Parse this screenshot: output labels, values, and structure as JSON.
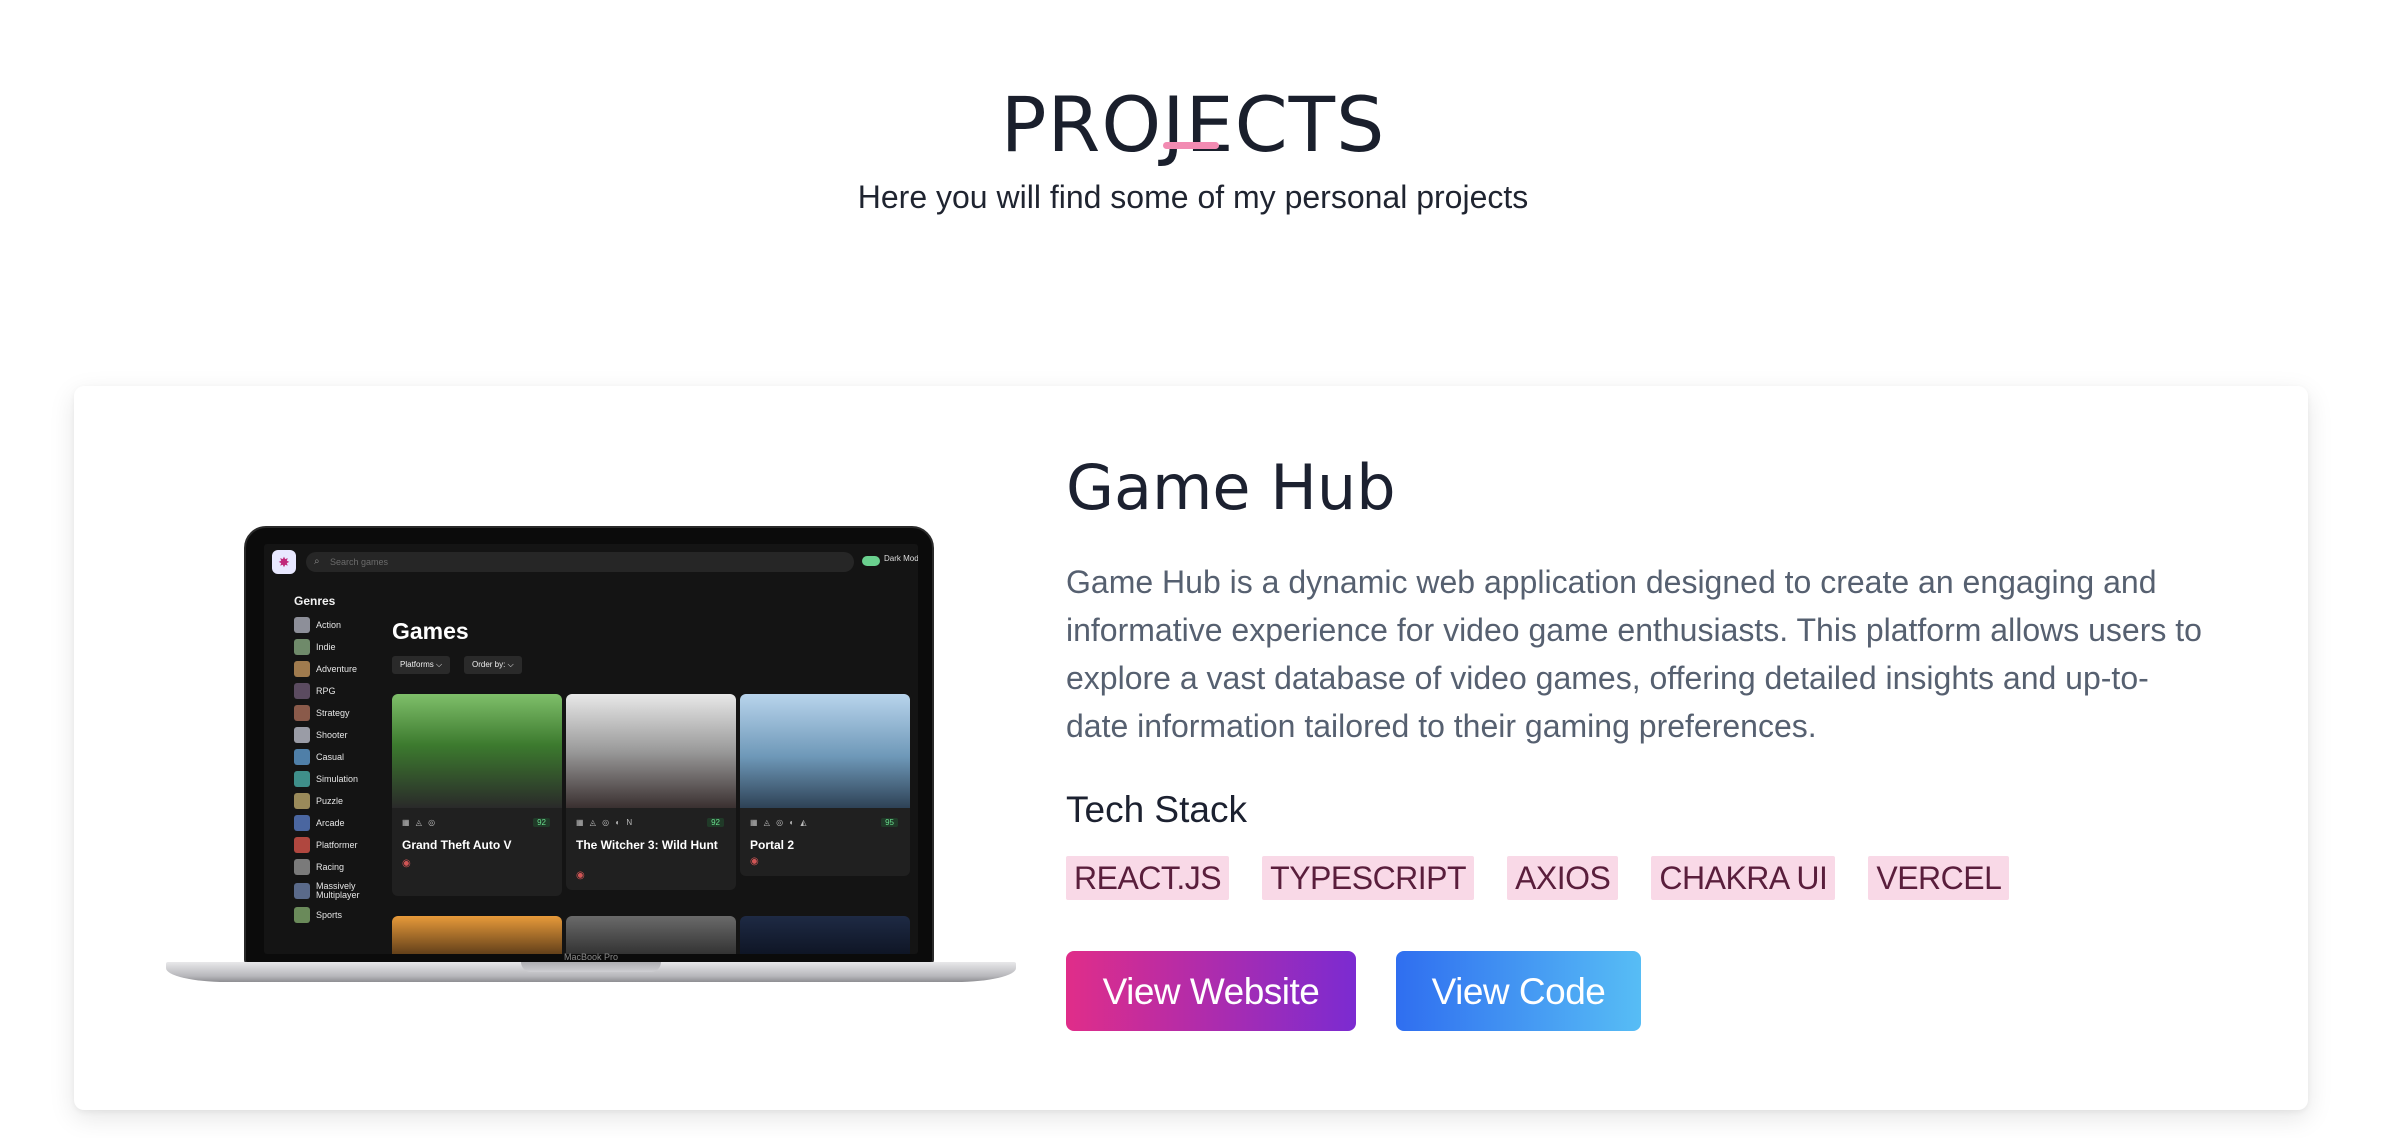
{
  "header": {
    "title": "PROJECTS",
    "subtitle": "Here you will find some of my personal projects",
    "accent_color": "#f28bb2"
  },
  "project": {
    "name": "Game Hub",
    "description": "Game Hub is a dynamic web application designed to create an engaging and informative experience for video game enthusiasts. This platform allows users to explore a vast database of video games, offering detailed insights and up-to-date information tailored to their gaming preferences.",
    "tech_stack_heading": "Tech Stack",
    "tech_stack": [
      "REACT.JS",
      "TYPESCRIPT",
      "AXIOS",
      "CHAKRA UI",
      "VERCEL"
    ],
    "buttons": {
      "view_website": "View Website",
      "view_code": "View Code"
    }
  },
  "screenshot": {
    "search_placeholder": "Search games",
    "dark_mode_label": "Dark Mode",
    "genres_heading": "Genres",
    "genres": [
      "Action",
      "Indie",
      "Adventure",
      "RPG",
      "Strategy",
      "Shooter",
      "Casual",
      "Simulation",
      "Puzzle",
      "Arcade",
      "Platformer",
      "Racing",
      "Massively Multiplayer",
      "Sports"
    ],
    "games_heading": "Games",
    "platforms_dropdown": "Platforms ⌵",
    "order_dropdown": "Order by: ⌵",
    "games": [
      {
        "name": "Grand Theft Auto V",
        "score": "92",
        "platforms": "▦ ◬ ◎"
      },
      {
        "name": "The Witcher 3: Wild Hunt",
        "score": "92",
        "platforms": "▦ ◬ ◎ ◐ N"
      },
      {
        "name": "Portal 2",
        "score": "95",
        "platforms": "▦ ◬ ◎ ◐ ◭"
      }
    ],
    "device_label": "MacBook Pro"
  }
}
